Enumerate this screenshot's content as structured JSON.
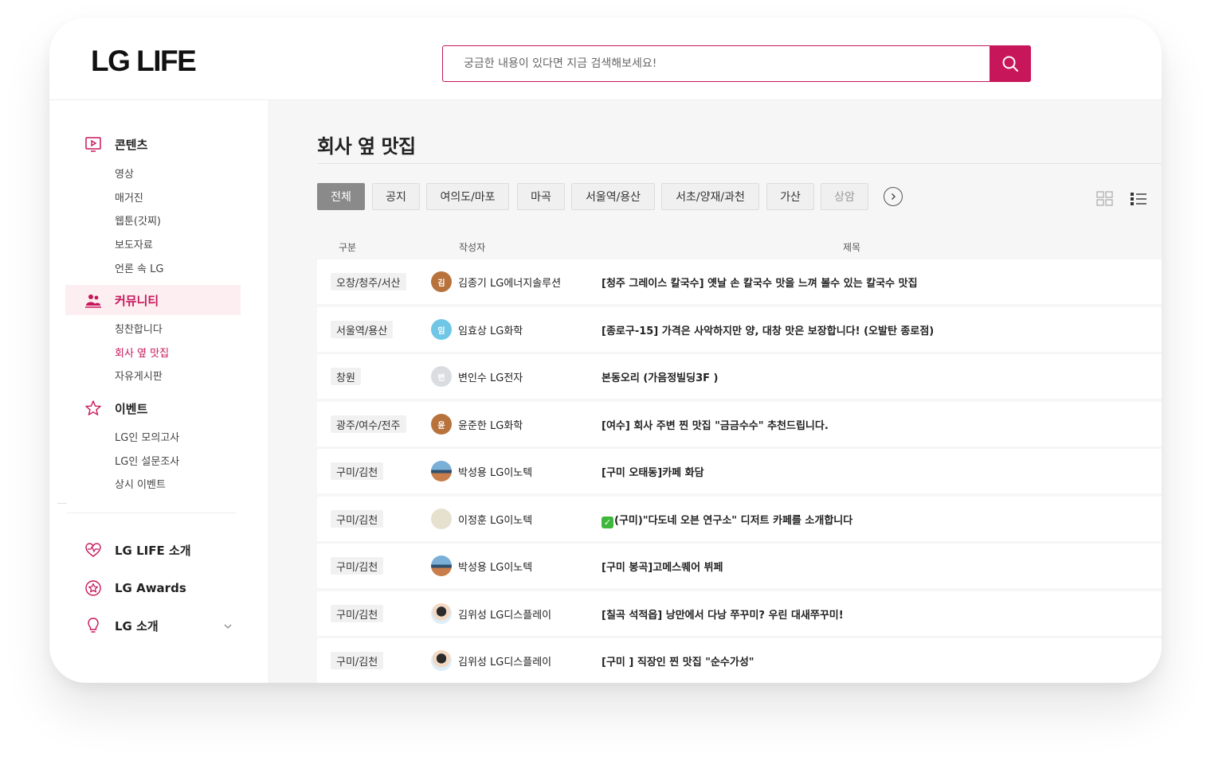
{
  "header": {
    "logo": "LG LIFE",
    "search_placeholder": "궁금한 내용이 있다면 지금 검색해보세요!"
  },
  "sidebar": {
    "sections": [
      {
        "label": "콘텐츠",
        "items": [
          "영상",
          "매거진",
          "웹툰(갓찌)",
          "보도자료",
          "언론 속 LG"
        ]
      },
      {
        "label": "커뮤니티",
        "items": [
          "칭찬합니다",
          "회사 옆 맛집",
          "자유게시판"
        ]
      },
      {
        "label": "이벤트",
        "items": [
          "LG인 모의고사",
          "LG인 설문조사",
          "상시 이벤트"
        ]
      }
    ],
    "bottom": [
      "LG LIFE 소개",
      "LG Awards",
      "LG 소개"
    ]
  },
  "main": {
    "title": "회사 옆 맛집",
    "tabs": [
      "전체",
      "공지",
      "여의도/마포",
      "마곡",
      "서울역/용산",
      "서초/양재/과천",
      "가산",
      "상암"
    ],
    "columns": [
      "구분",
      "작성자",
      "제목"
    ],
    "rows": [
      {
        "category": "오창/청주/서산",
        "author": "김종기 LG에너지솔루션",
        "avatar": "김",
        "title": "[청주 그레이스 칼국수] 옛날 손 칼국수 맛을 느껴 볼수 있는 칼국수 맛집"
      },
      {
        "category": "서울역/용산",
        "author": "임효상 LG화학",
        "avatar": "임",
        "title": "[종로구-15] 가격은 사악하지만 양, 대창 맛은 보장합니다! (오발탄 종로점)"
      },
      {
        "category": "창원",
        "author": "변인수 LG전자",
        "avatar": "변",
        "title": "본동오리 (가음정빌딩3F )"
      },
      {
        "category": "광주/여수/전주",
        "author": "윤준한 LG화학",
        "avatar": "윤",
        "title": "[여수] 회사 주변 찐 맛집 \"금금수수\" 추천드립니다."
      },
      {
        "category": "구미/김천",
        "author": "박성용 LG이노텍",
        "avatar": "",
        "title": "[구미 오태동]카페 화담"
      },
      {
        "category": "구미/김천",
        "author": "이정훈 LG이노텍",
        "avatar": "",
        "title": "(구미)\"다도네 오븐 연구소\" 디저트 카페를 소개합니다"
      },
      {
        "category": "구미/김천",
        "author": "박성용 LG이노텍",
        "avatar": "",
        "title": "[구미 봉곡]고메스퀘어 뷔페"
      },
      {
        "category": "구미/김천",
        "author": "김위성 LG디스플레이",
        "avatar": "",
        "title": "[칠곡 석적읍] 낭만에서 다낭 쭈꾸미? 우린 대새쭈꾸미!"
      },
      {
        "category": "구미/김천",
        "author": "김위성 LG디스플레이",
        "avatar": "",
        "title": "[구미 ] 직장인 찐 맛집 \"순수가성\""
      }
    ]
  },
  "colors": {
    "accent": "#c7175a",
    "active_bg": "#fdeef2",
    "main_bg": "#f6f6f6"
  },
  "icons": [
    "content-icon",
    "community-icon",
    "event-star-icon",
    "heart-pulse-icon",
    "award-icon",
    "bulb-icon",
    "search-icon",
    "grid-view-icon",
    "list-view-icon",
    "next-arrow-icon",
    "chevron-down-icon"
  ]
}
